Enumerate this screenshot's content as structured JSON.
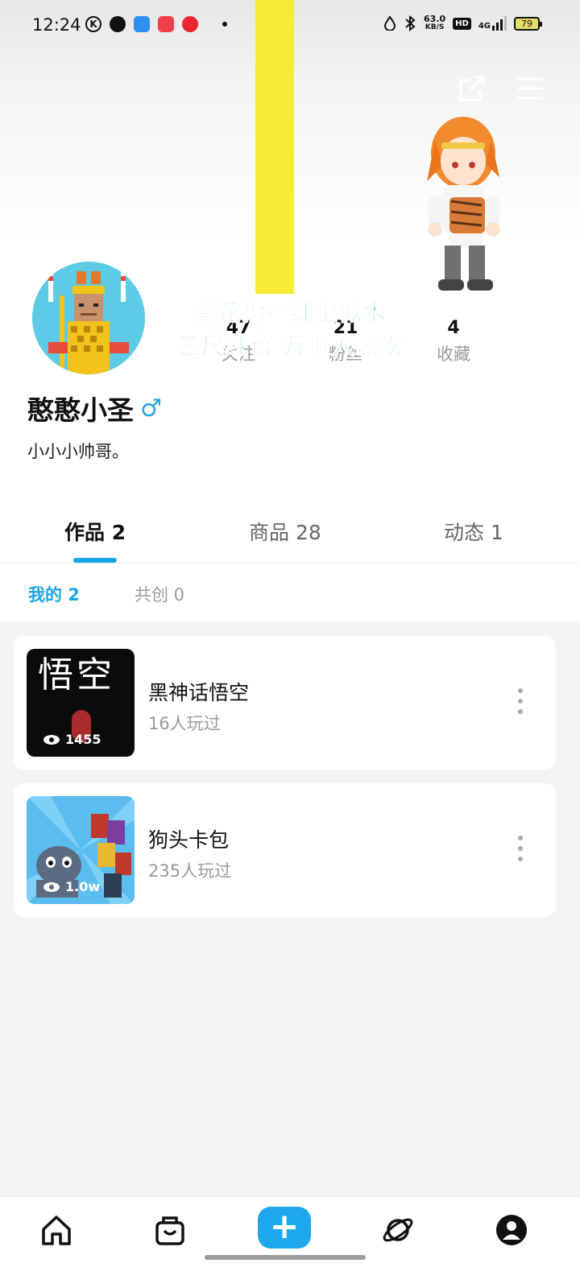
{
  "status_bar": {
    "time": "12:24",
    "network_speed_value": "63.0",
    "network_speed_unit": "KB/S",
    "hd_label": "HD",
    "cell_label": "4G",
    "battery": "79"
  },
  "header": {
    "share_icon": "share-icon",
    "menu_icon": "menu-icon"
  },
  "overlay_text": {
    "line1": "兰花指捻红尘似水",
    "line2": "三尺红台 万事入歌吹"
  },
  "profile": {
    "name": "憨憨小圣",
    "gender_symbol": "♂",
    "bio": "小小小帅哥。"
  },
  "stats": [
    {
      "value": "47",
      "label": "关注"
    },
    {
      "value": "21",
      "label": "粉丝"
    },
    {
      "value": "4",
      "label": "收藏"
    }
  ],
  "tabs": [
    {
      "label": "作品 2"
    },
    {
      "label": "商品 28"
    },
    {
      "label": "动态 1"
    }
  ],
  "subtabs": [
    {
      "label": "我的 2"
    },
    {
      "label": "共创 0"
    }
  ],
  "works": [
    {
      "title": "黑神话悟空",
      "plays": "16人玩过",
      "views": "1455",
      "thumb_text": "悟空"
    },
    {
      "title": "狗头卡包",
      "plays": "235人玩过",
      "views": "1.0w"
    }
  ],
  "colors": {
    "accent": "#1aa6e4",
    "add_button": "#1fa7ec",
    "banner_yellow": "#f7ec35"
  }
}
